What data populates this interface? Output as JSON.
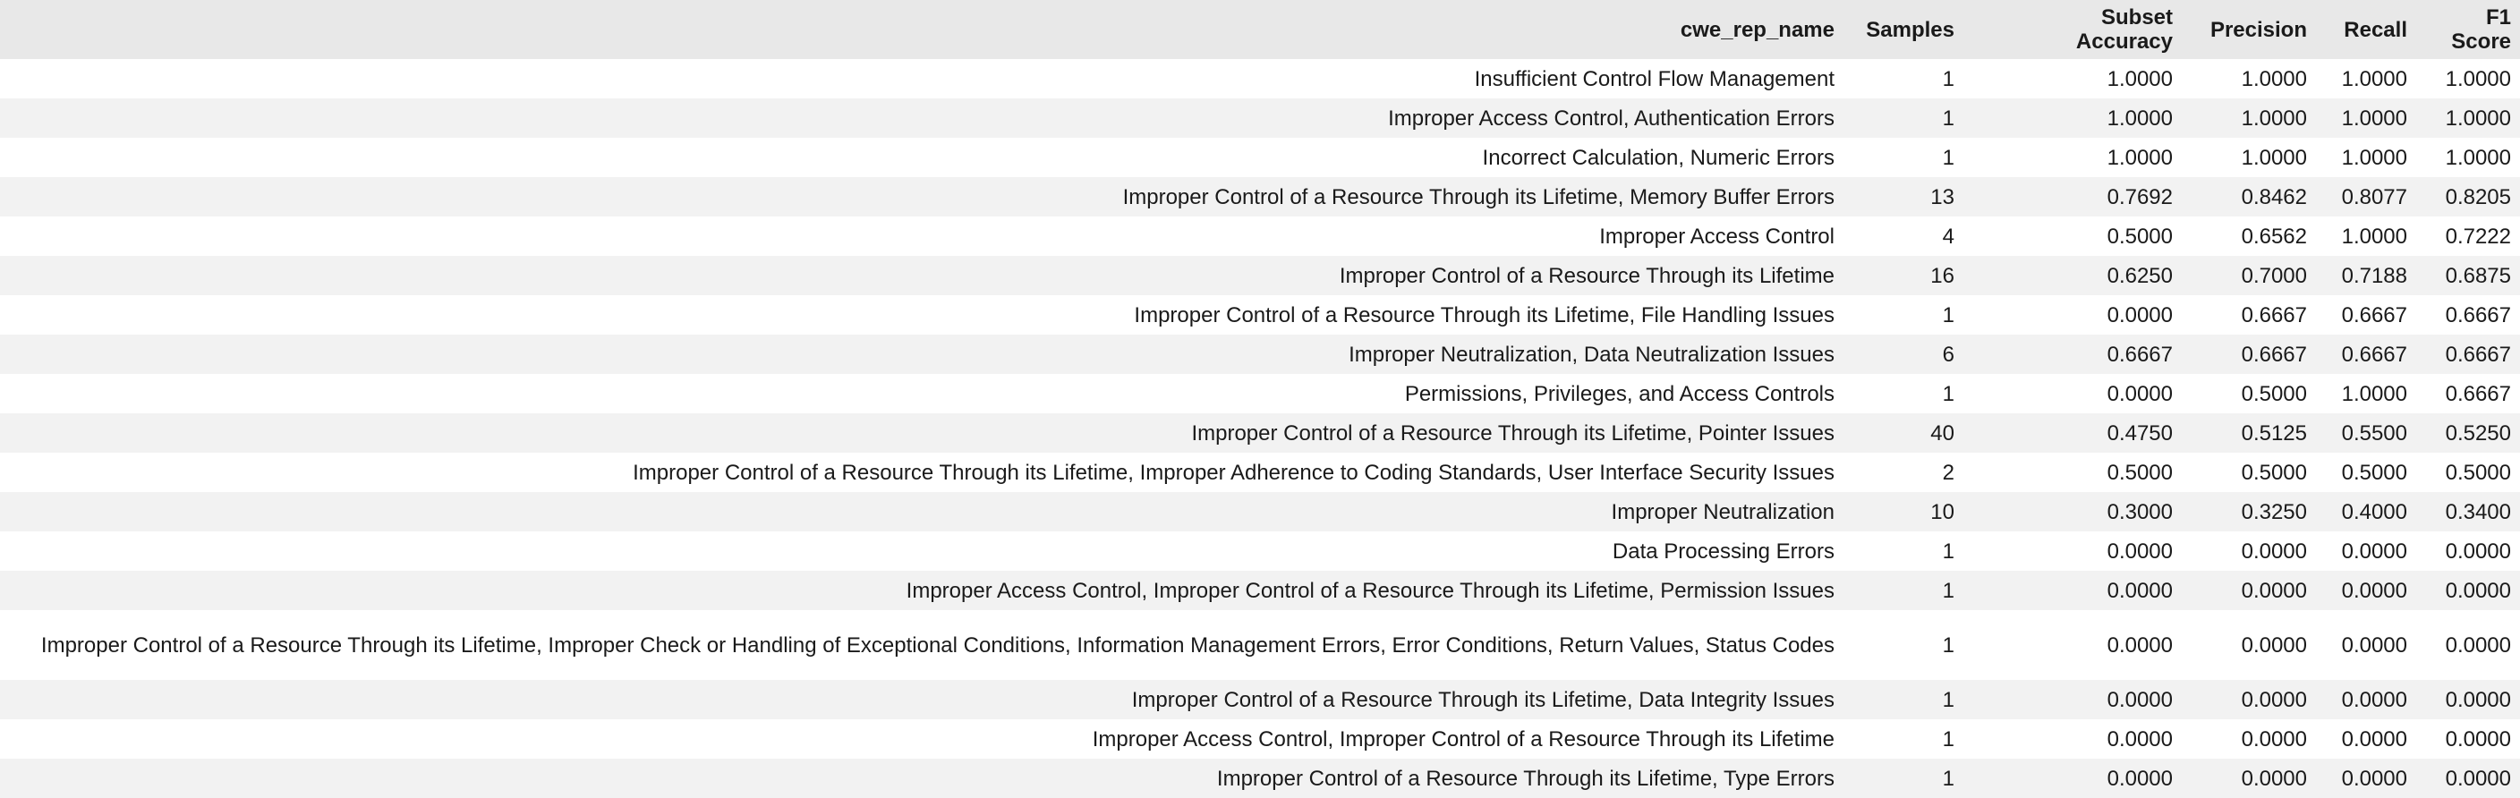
{
  "table": {
    "columns": {
      "name": "cwe_rep_name",
      "samples": "Samples",
      "subset_accuracy_1": "Subset",
      "subset_accuracy_2": "Accuracy",
      "precision": "Precision",
      "recall": "Recall",
      "f1_1": "F1",
      "f1_2": "Score"
    },
    "rows": [
      {
        "name": "Insufficient Control Flow Management",
        "samples": "1",
        "acc": "1.0000",
        "prec": "1.0000",
        "rec": "1.0000",
        "f1": "1.0000"
      },
      {
        "name": "Improper Access Control, Authentication Errors",
        "samples": "1",
        "acc": "1.0000",
        "prec": "1.0000",
        "rec": "1.0000",
        "f1": "1.0000"
      },
      {
        "name": "Incorrect Calculation, Numeric Errors",
        "samples": "1",
        "acc": "1.0000",
        "prec": "1.0000",
        "rec": "1.0000",
        "f1": "1.0000"
      },
      {
        "name": "Improper Control of a Resource Through its Lifetime, Memory Buffer Errors",
        "samples": "13",
        "acc": "0.7692",
        "prec": "0.8462",
        "rec": "0.8077",
        "f1": "0.8205"
      },
      {
        "name": "Improper Access Control",
        "samples": "4",
        "acc": "0.5000",
        "prec": "0.6562",
        "rec": "1.0000",
        "f1": "0.7222"
      },
      {
        "name": "Improper Control of a Resource Through its Lifetime",
        "samples": "16",
        "acc": "0.6250",
        "prec": "0.7000",
        "rec": "0.7188",
        "f1": "0.6875"
      },
      {
        "name": "Improper Control of a Resource Through its Lifetime, File Handling Issues",
        "samples": "1",
        "acc": "0.0000",
        "prec": "0.6667",
        "rec": "0.6667",
        "f1": "0.6667"
      },
      {
        "name": "Improper Neutralization, Data Neutralization Issues",
        "samples": "6",
        "acc": "0.6667",
        "prec": "0.6667",
        "rec": "0.6667",
        "f1": "0.6667"
      },
      {
        "name": "Permissions, Privileges, and Access Controls",
        "samples": "1",
        "acc": "0.0000",
        "prec": "0.5000",
        "rec": "1.0000",
        "f1": "0.6667"
      },
      {
        "name": "Improper Control of a Resource Through its Lifetime, Pointer Issues",
        "samples": "40",
        "acc": "0.4750",
        "prec": "0.5125",
        "rec": "0.5500",
        "f1": "0.5250"
      },
      {
        "name": "Improper Control of a Resource Through its Lifetime, Improper Adherence to Coding Standards, User Interface Security Issues",
        "samples": "2",
        "acc": "0.5000",
        "prec": "0.5000",
        "rec": "0.5000",
        "f1": "0.5000"
      },
      {
        "name": "Improper Neutralization",
        "samples": "10",
        "acc": "0.3000",
        "prec": "0.3250",
        "rec": "0.4000",
        "f1": "0.3400"
      },
      {
        "name": "Data Processing Errors",
        "samples": "1",
        "acc": "0.0000",
        "prec": "0.0000",
        "rec": "0.0000",
        "f1": "0.0000"
      },
      {
        "name": "Improper Access Control, Improper Control of a Resource Through its Lifetime, Permission Issues",
        "samples": "1",
        "acc": "0.0000",
        "prec": "0.0000",
        "rec": "0.0000",
        "f1": "0.0000"
      },
      {
        "name": "Improper Control of a Resource Through its Lifetime, Improper Check or Handling of Exceptional Conditions, Information Management Errors, Error Conditions, Return Values, Status Codes",
        "samples": "1",
        "acc": "0.0000",
        "prec": "0.0000",
        "rec": "0.0000",
        "f1": "0.0000"
      },
      {
        "name": "Improper Control of a Resource Through its Lifetime, Data Integrity Issues",
        "samples": "1",
        "acc": "0.0000",
        "prec": "0.0000",
        "rec": "0.0000",
        "f1": "0.0000"
      },
      {
        "name": "Improper Access Control, Improper Control of a Resource Through its Lifetime",
        "samples": "1",
        "acc": "0.0000",
        "prec": "0.0000",
        "rec": "0.0000",
        "f1": "0.0000"
      },
      {
        "name": "Improper Control of a Resource Through its Lifetime, Type Errors",
        "samples": "1",
        "acc": "0.0000",
        "prec": "0.0000",
        "rec": "0.0000",
        "f1": "0.0000"
      }
    ]
  }
}
